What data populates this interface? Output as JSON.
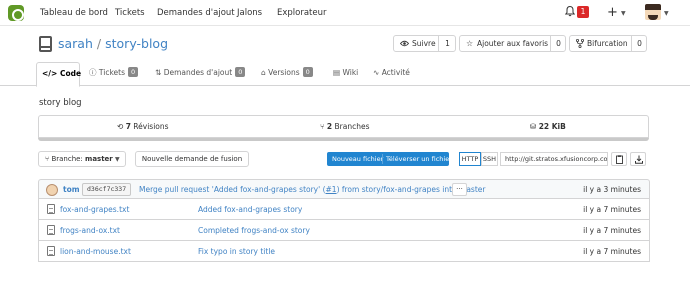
{
  "nav": {
    "items": [
      "Tableau de bord",
      "Tickets",
      "Demandes d'ajout",
      "Jalons",
      "Explorateur"
    ],
    "notification_count": "1",
    "plus": "+"
  },
  "repo": {
    "owner": "sarah",
    "separator": "/",
    "name": "story-blog",
    "watch_label": "Suivre",
    "watch_count": "1",
    "star_label": "Ajouter aux favoris",
    "star_count": "0",
    "fork_label": "Bifurcation",
    "fork_count": "0"
  },
  "tabs": [
    {
      "label": "Code",
      "icon": "code-icon",
      "count": null
    },
    {
      "label": "Tickets",
      "icon": "issue-icon",
      "count": "0"
    },
    {
      "label": "Demandes d'ajout",
      "icon": "pull-request-icon",
      "count": "0"
    },
    {
      "label": "Versions",
      "icon": "tag-icon",
      "count": "0"
    },
    {
      "label": "Wiki",
      "icon": "book-icon",
      "count": null
    },
    {
      "label": "Activité",
      "icon": "pulse-icon",
      "count": null
    }
  ],
  "description": "story blog",
  "stats": {
    "commits_num": "7",
    "commits_label": "Révisions",
    "branches_num": "2",
    "branches_label": "Branches",
    "size": "22 KiB"
  },
  "branch": {
    "label": "Branche:",
    "value": "master",
    "new_pr": "Nouvelle demande de fusion",
    "new_file": "Nouveau fichier",
    "upload_file": "Téléverser un fichier",
    "http": "HTTP",
    "ssh": "SSH",
    "clone_url": "http://git.stratos.xfusioncorp.com/"
  },
  "latest_commit": {
    "author": "tom",
    "sha": "d36cf7c337",
    "message_prefix": "Merge pull request 'Added fox-and-grapes story' (",
    "message_link": "#1",
    "message_suffix": ") from story/fox-and-grapes into master",
    "more": "···",
    "age": "il y a 3 minutes"
  },
  "files": [
    {
      "name": "fox-and-grapes.txt",
      "message": "Added fox-and-grapes story",
      "age": "il y a 7 minutes"
    },
    {
      "name": "frogs-and-ox.txt",
      "message": "Completed frogs-and-ox story",
      "age": "il y a 7 minutes"
    },
    {
      "name": "lion-and-mouse.txt",
      "message": "Fix typo in story title",
      "age": "il y a 7 minutes"
    }
  ],
  "colors": {
    "link": "#4183c4",
    "primary_button": "#2185d0",
    "logo": "#609926",
    "notification": "#db2828"
  }
}
